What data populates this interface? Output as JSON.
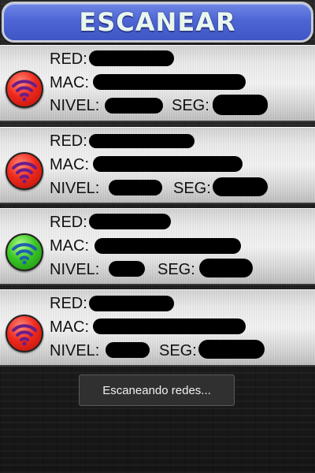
{
  "scan_button": {
    "label": "ESCANEAR"
  },
  "labels": {
    "red": "RED:",
    "mac": "MAC:",
    "nivel": "NIVEL:",
    "seg": "SEG:"
  },
  "networks": [
    {
      "signal_color": "red",
      "signal_icon": "wifi-icon"
    },
    {
      "signal_color": "red",
      "signal_icon": "wifi-icon"
    },
    {
      "signal_color": "green",
      "signal_icon": "wifi-icon"
    },
    {
      "signal_color": "red",
      "signal_icon": "wifi-icon"
    }
  ],
  "colors": {
    "red": "#ee2a1d",
    "green": "#39c624",
    "button": "#4e66d5"
  },
  "toast": {
    "text": "Escaneando redes..."
  }
}
